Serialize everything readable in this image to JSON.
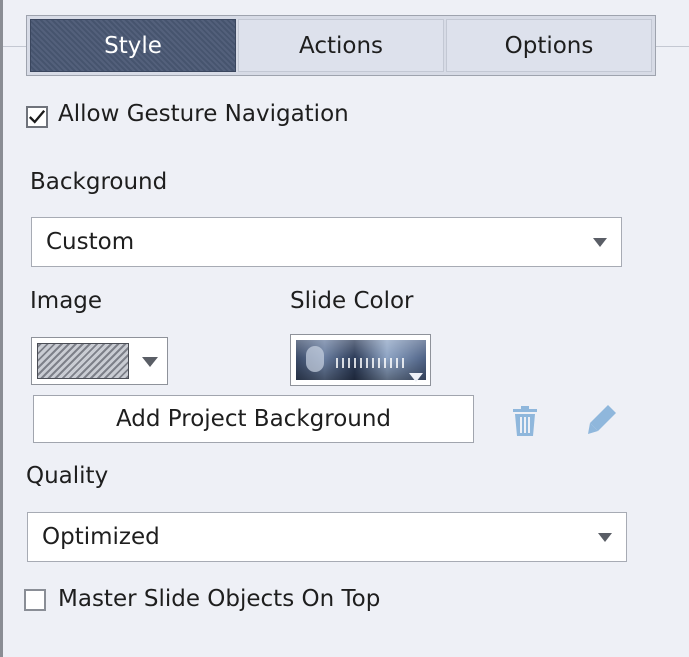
{
  "tabs": [
    {
      "label": "Style",
      "active": true
    },
    {
      "label": "Actions",
      "active": false
    },
    {
      "label": "Options",
      "active": false
    }
  ],
  "gesture_nav": {
    "label": "Allow Gesture Navigation",
    "checked": true
  },
  "background": {
    "label": "Background",
    "value": "Custom"
  },
  "image": {
    "label": "Image"
  },
  "slide_color": {
    "label": "Slide Color"
  },
  "add_bg_button": "Add Project Background",
  "icons": {
    "delete": "trash-icon",
    "edit": "pencil-icon"
  },
  "quality": {
    "label": "Quality",
    "value": "Optimized"
  },
  "master_on_top": {
    "label": "Master Slide Objects On Top",
    "checked": false
  },
  "colors": {
    "accent": "#4a5874",
    "icon_blue": "#8fb7dc"
  }
}
